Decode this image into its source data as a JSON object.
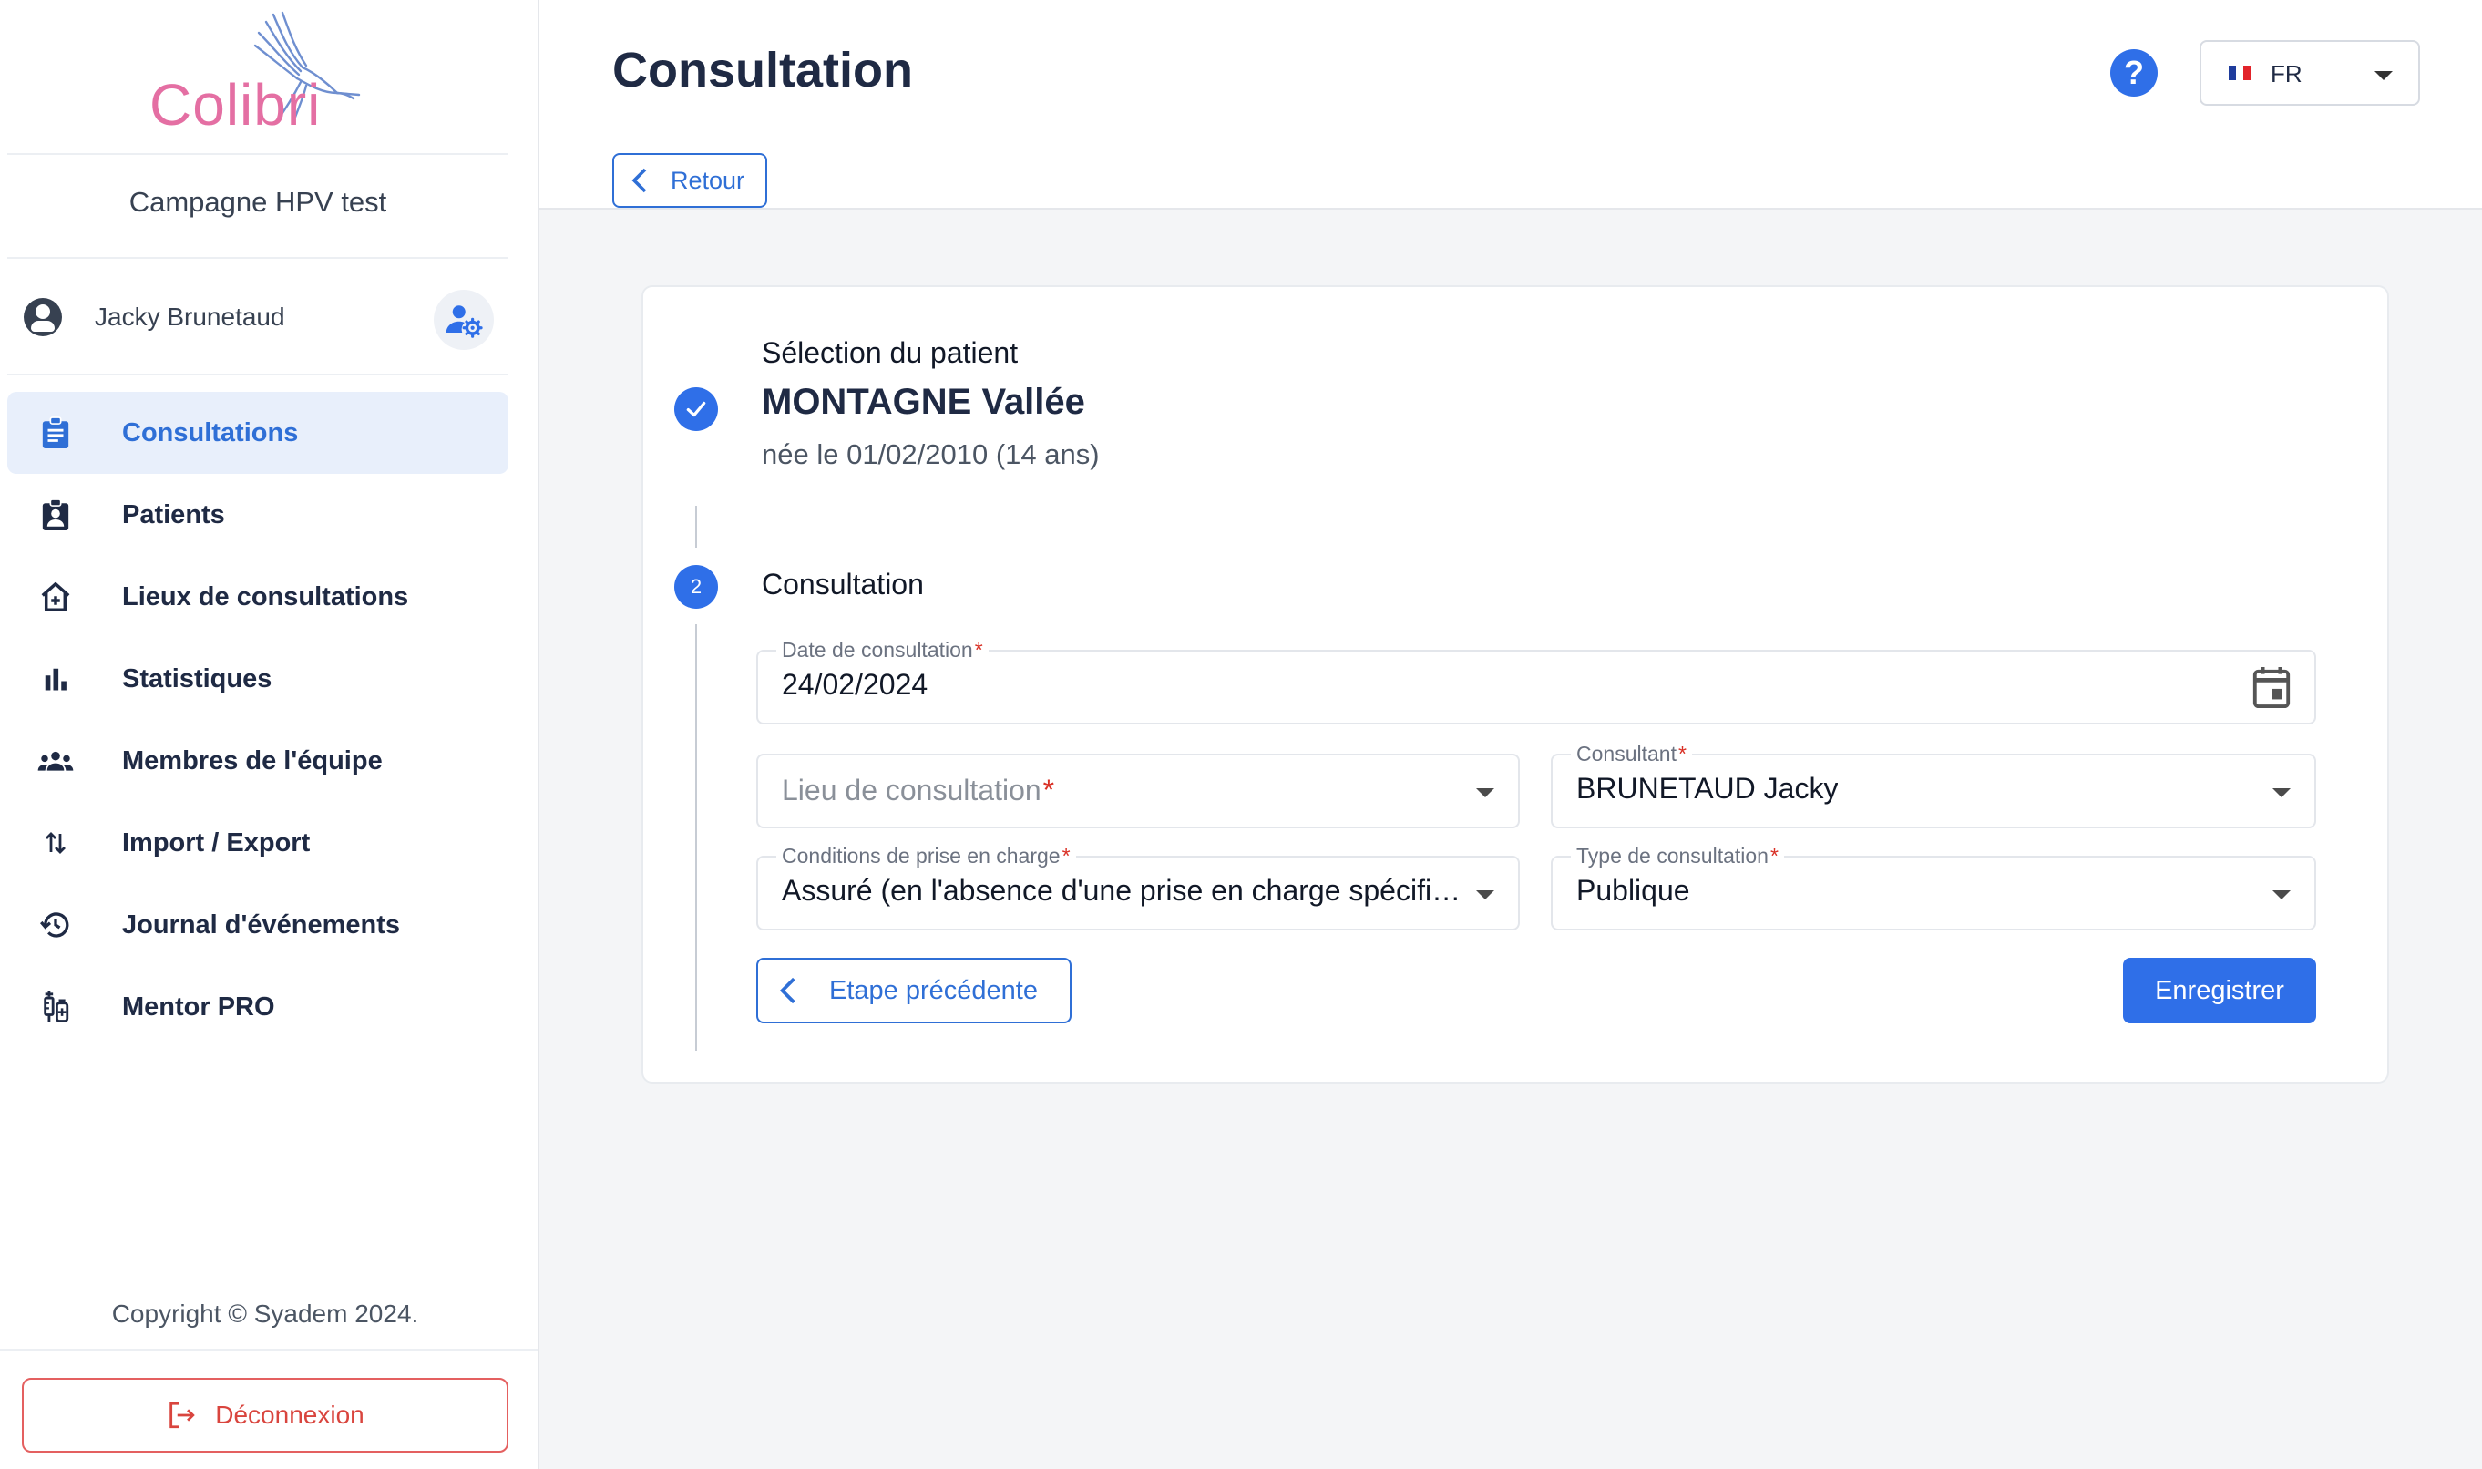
{
  "sidebar": {
    "logo_text": "Colibri",
    "campaign": "Campagne HPV test",
    "user_name": "Jacky Brunetaud",
    "nav": [
      {
        "label": "Consultations",
        "icon": "clipboard-icon",
        "active": true
      },
      {
        "label": "Patients",
        "icon": "patient-badge-icon",
        "active": false
      },
      {
        "label": "Lieux de consultations",
        "icon": "home-plus-icon",
        "active": false
      },
      {
        "label": "Statistiques",
        "icon": "bar-chart-icon",
        "active": false
      },
      {
        "label": "Membres de l'équipe",
        "icon": "team-icon",
        "active": false
      },
      {
        "label": "Import / Export",
        "icon": "import-export-icon",
        "active": false
      },
      {
        "label": "Journal d'événements",
        "icon": "history-icon",
        "active": false
      },
      {
        "label": "Mentor PRO",
        "icon": "vaccine-icon",
        "active": false
      }
    ],
    "copyright": "Copyright © Syadem 2024.",
    "logout_label": "Déconnexion"
  },
  "header": {
    "title": "Consultation",
    "help": "?",
    "language": "FR",
    "back_label": "Retour"
  },
  "stepper": {
    "step1": {
      "title": "Sélection du patient",
      "patient_name": "MONTAGNE Vallée",
      "patient_dob": "née le 01/02/2010 (14 ans)"
    },
    "step2": {
      "number": "2",
      "title": "Consultation"
    }
  },
  "form": {
    "date": {
      "label": "Date de consultation",
      "value": "24/02/2024"
    },
    "lieu": {
      "placeholder": "Lieu de consultation"
    },
    "consultant": {
      "label": "Consultant",
      "value": "BRUNETAUD Jacky"
    },
    "conditions": {
      "label": "Conditions de prise en charge",
      "value": "Assuré (en l'absence d'une prise en charge spécifique)"
    },
    "type": {
      "label": "Type de consultation",
      "value": "Publique"
    },
    "required_marker": "*",
    "prev_label": "Etape précédente",
    "save_label": "Enregistrer"
  },
  "colors": {
    "accent": "#2f6fe8",
    "logout": "#d9453e",
    "active_bg": "#e8effb",
    "logo_pink": "#e46fa3"
  }
}
